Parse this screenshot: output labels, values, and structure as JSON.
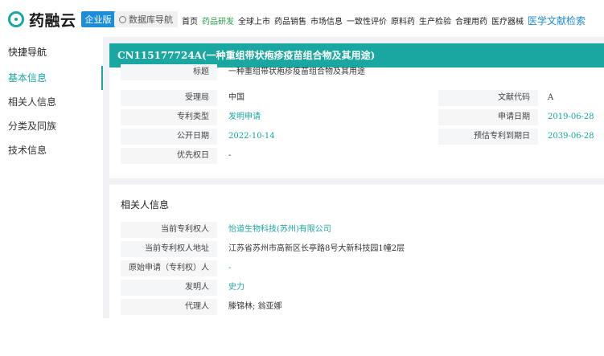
{
  "header": {
    "logo_text": "药融云",
    "logo_badge": "企业版",
    "db_nav": "数据库导航",
    "menu": [
      {
        "label": "首页",
        "state": "normal"
      },
      {
        "label": "药品研发",
        "state": "active"
      },
      {
        "label": "全球上市",
        "state": "normal"
      },
      {
        "label": "药品销售",
        "state": "normal"
      },
      {
        "label": "市场信息",
        "state": "normal"
      },
      {
        "label": "一致性评价",
        "state": "normal"
      },
      {
        "label": "原料药",
        "state": "normal"
      },
      {
        "label": "生产检验",
        "state": "normal"
      },
      {
        "label": "合理用药",
        "state": "normal"
      },
      {
        "label": "医疗器械",
        "state": "normal"
      },
      {
        "label": "医学文献检索",
        "state": "lit"
      }
    ]
  },
  "sidebar": {
    "title": "快捷导航",
    "items": [
      {
        "label": "基本信息",
        "active": true
      },
      {
        "label": "相关人信息",
        "active": false
      },
      {
        "label": "分类及同族",
        "active": false
      },
      {
        "label": "技术信息",
        "active": false
      }
    ]
  },
  "basic": {
    "patent_title": "CN115177724A(一种重组带状疱疹疫苗组合物及其用途)",
    "title_label": "标题",
    "title_value": "一种重组带状疱疹疫苗组合物及其用途",
    "office_label": "受理局",
    "office_value": "中国",
    "doc_code_label": "文献代码",
    "doc_code_value": "A",
    "type_label": "专利类型",
    "type_value": "发明申请",
    "apply_date_label": "申请日期",
    "apply_date_value": "2019-06-28",
    "pub_date_label": "公开日期",
    "pub_date_value": "2022-10-14",
    "expiry_label": "预估专利到期日",
    "expiry_value": "2039-06-28",
    "priority_label": "优先权日",
    "priority_value": "-"
  },
  "related": {
    "section_title": "相关人信息",
    "holder_label": "当前专利权人",
    "holder_value": "怡道生物科技(苏州)有限公司",
    "address_label": "当前专利权人地址",
    "address_value": "江苏省苏州市高新区长亭路8号大新科技园1幢2层",
    "orig_label": "原始申请（专利权）人",
    "orig_value": "-",
    "inventor_label": "发明人",
    "inventor_value": "史力",
    "agent_label": "代理人",
    "agent_value": "滕锦林; 翁亚娜"
  },
  "colors": {
    "accent": "#1aa7a1",
    "lit_link": "#1c8ed9",
    "active_menu": "#2aa04a"
  }
}
